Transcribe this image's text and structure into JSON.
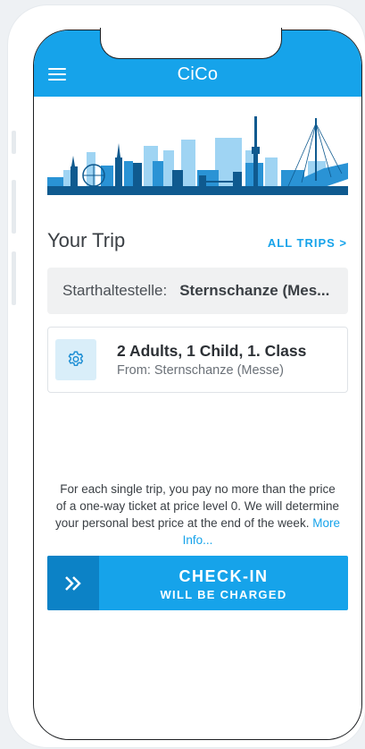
{
  "header": {
    "title": "CiCo"
  },
  "trip": {
    "section_title": "Your Trip",
    "all_trips_label": "ALL TRIPS >",
    "start_label": "Starthaltestelle:",
    "start_stop": "Sternschanze (Mes...",
    "card_title": "2 Adults, 1 Child, 1. Class",
    "card_subtitle": "From: Sternschanze (Messe)"
  },
  "info": {
    "text": "For each single trip, you pay no more than the price of a one-way ticket at price level 0. We will determine your personal best price at the end of the week.",
    "link": "More Info..."
  },
  "checkin": {
    "label": "CHECK-IN",
    "sublabel": "WILL BE CHARGED"
  },
  "colors": {
    "accent": "#16a3ea",
    "accent_dark": "#0c82c6",
    "skyline_light": "#9fd4f3",
    "skyline_dark": "#0f5a8f"
  },
  "icons": [
    "menu-icon",
    "gear-icon",
    "chevron-double-right-icon"
  ]
}
